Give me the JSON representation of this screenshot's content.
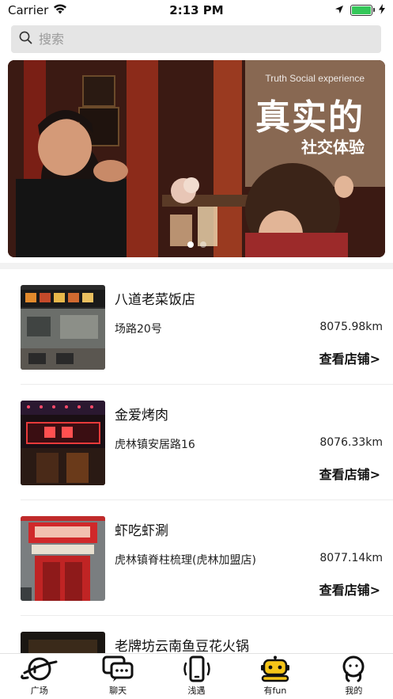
{
  "status_bar": {
    "carrier": "Carrier",
    "time": "2:13 PM",
    "battery_level": 1.0
  },
  "search": {
    "placeholder": "搜索"
  },
  "banner": {
    "subtitle": "Truth Social experience",
    "title": "真实的",
    "title2": "社交体验",
    "page_count": 2,
    "active_page": 0
  },
  "shops": [
    {
      "name": "八道老菜饭店",
      "address": "场路20号",
      "distance": "8075.98km",
      "link_label": "查看店铺>"
    },
    {
      "name": "金爱烤肉",
      "address": "虎林镇安居路16",
      "distance": "8076.33km",
      "link_label": "查看店铺>"
    },
    {
      "name": "虾吃虾涮",
      "address": "虎林镇脊柱梳理(虎林加盟店)",
      "distance": "8077.14km",
      "link_label": "查看店铺>"
    },
    {
      "name": "老牌坊云南鱼豆花火锅",
      "address": "",
      "distance": "",
      "link_label": ""
    }
  ],
  "tabs": [
    {
      "label": "广场",
      "icon": "planet-icon"
    },
    {
      "label": "聊天",
      "icon": "chat-icon"
    },
    {
      "label": "浅遇",
      "icon": "phone-icon"
    },
    {
      "label": "有fun",
      "icon": "robot-icon"
    },
    {
      "label": "我的",
      "icon": "profile-icon"
    }
  ],
  "colors": {
    "accent_yellow": "#f5c518",
    "search_bg": "#e5e5e5",
    "battery_green": "#34c759"
  }
}
